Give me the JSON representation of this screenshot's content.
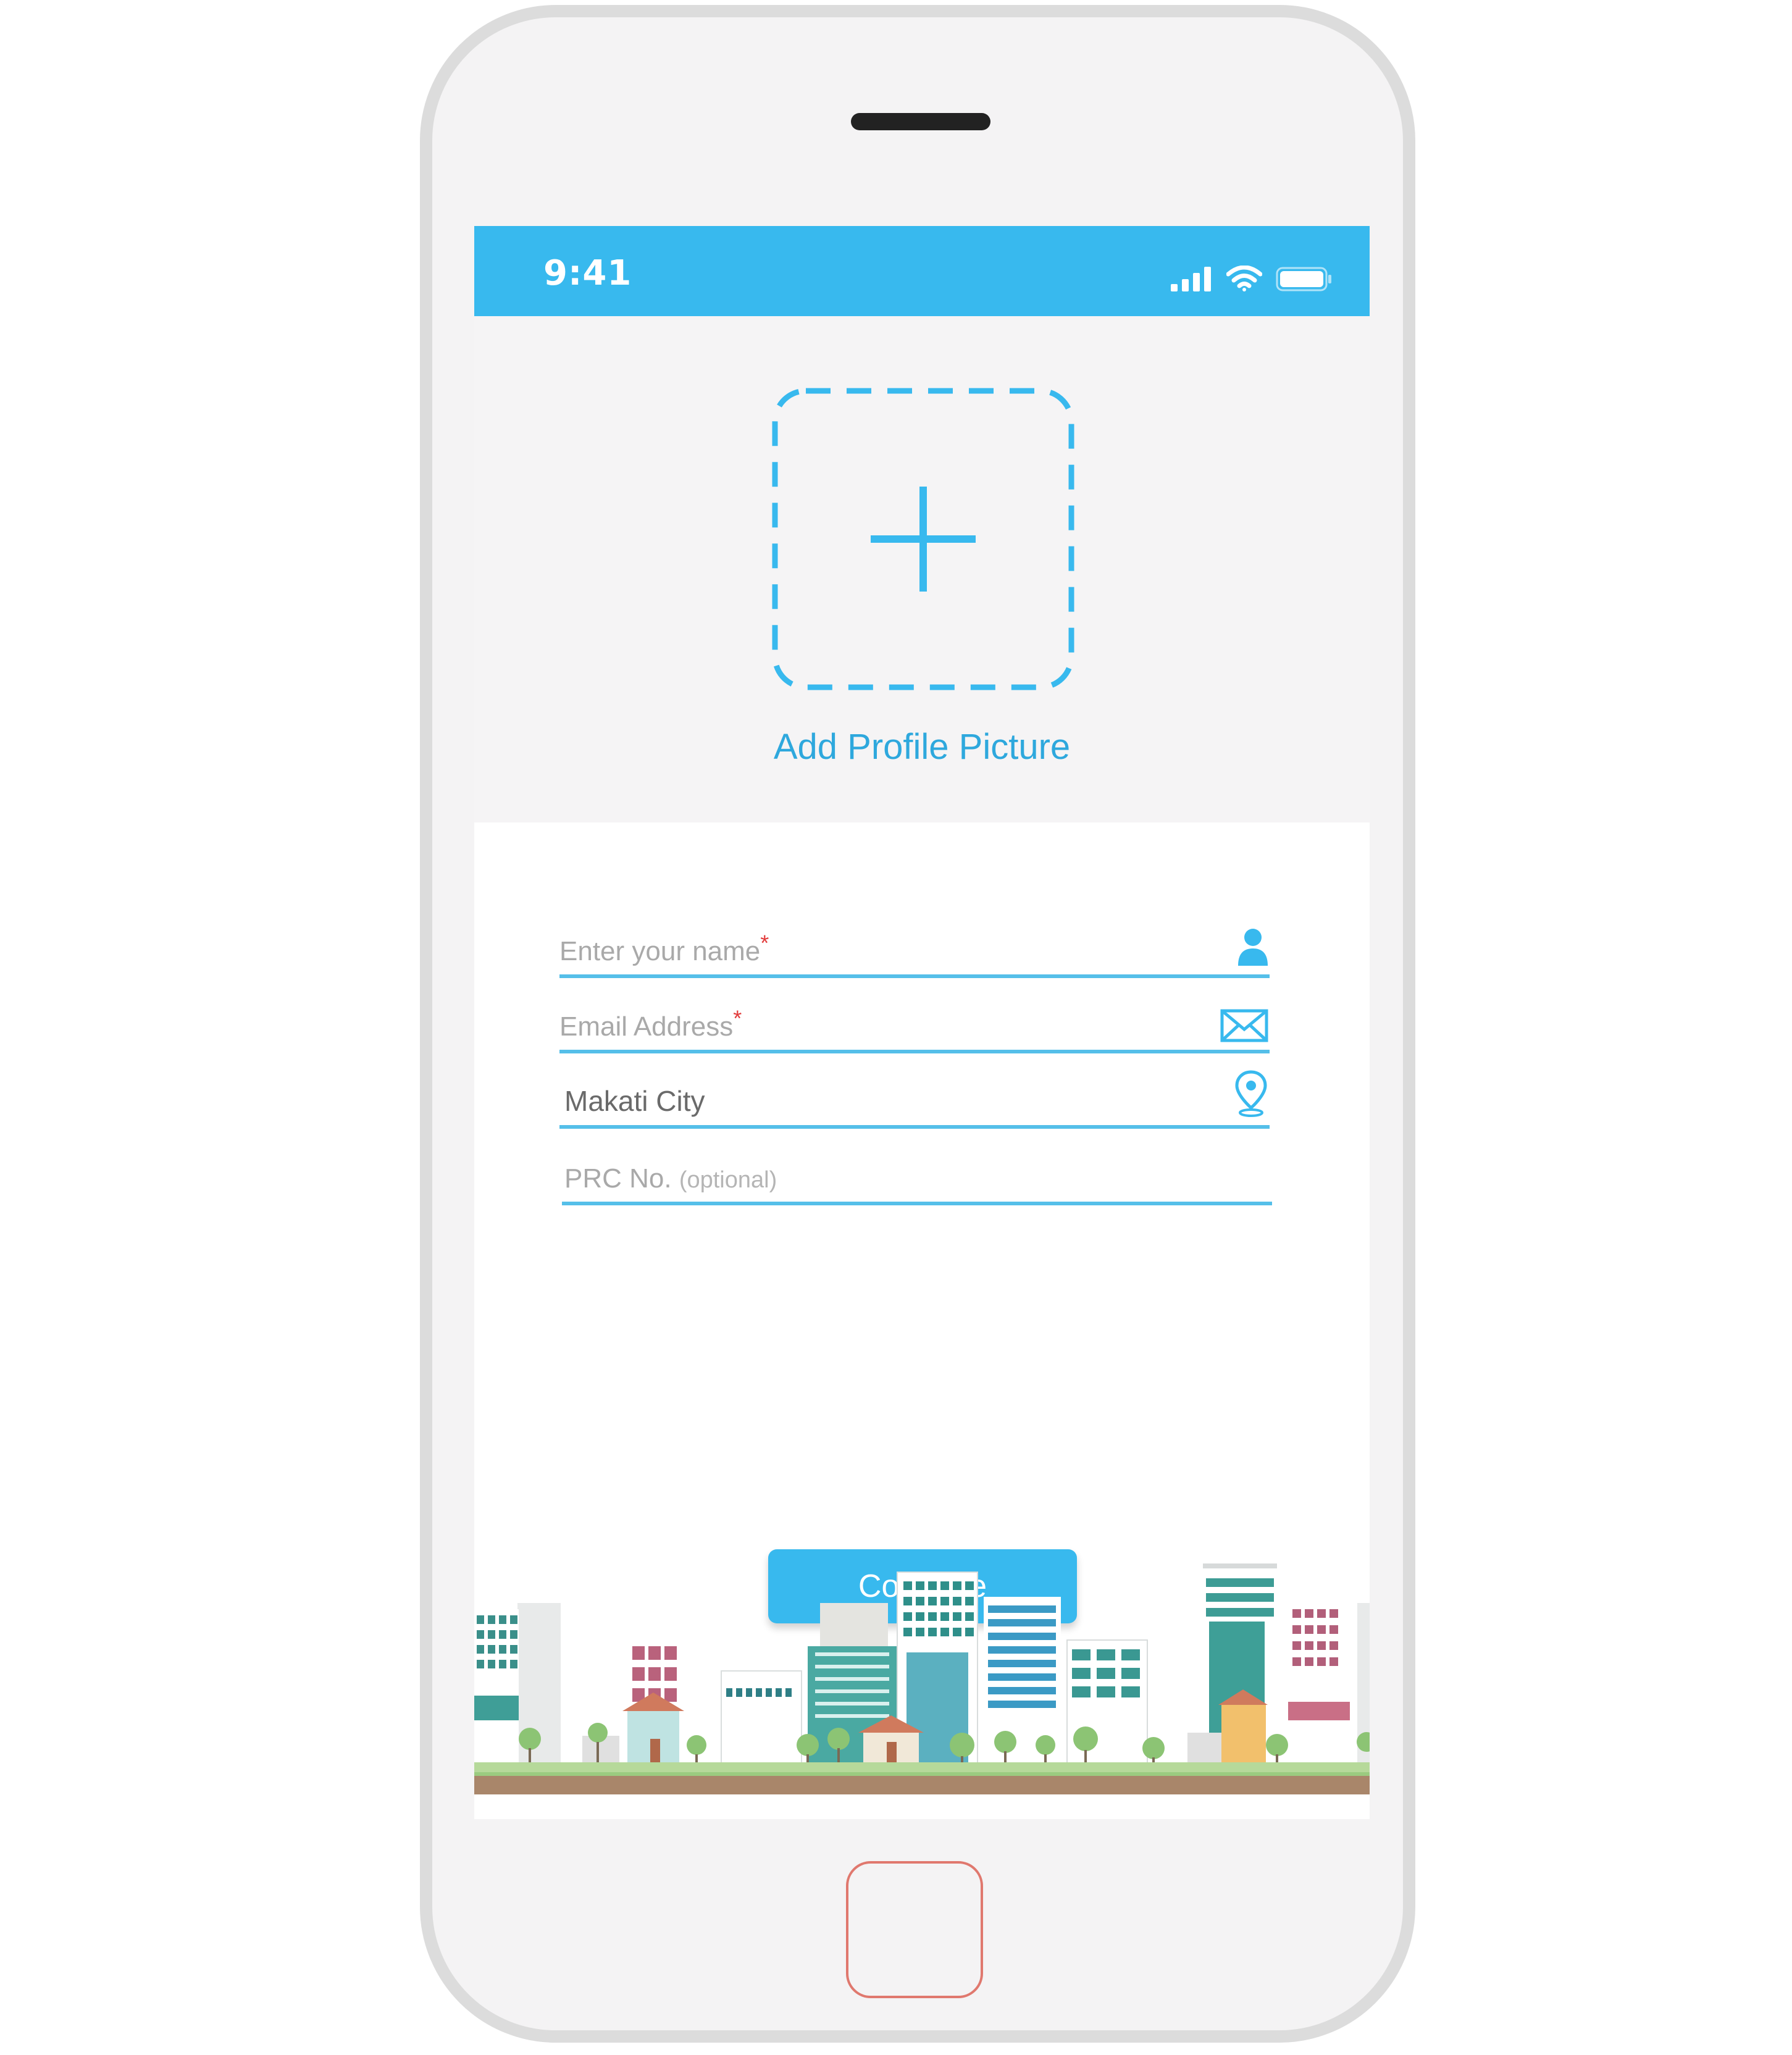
{
  "status_bar": {
    "time": "9:41",
    "icons": [
      "signal-icon",
      "wifi-icon",
      "battery-icon"
    ]
  },
  "profile": {
    "add_label": "Add Profile Picture",
    "icon": "plus-icon"
  },
  "form": {
    "fields": [
      {
        "placeholder": "Enter your name",
        "required": true,
        "required_mark": "*",
        "icon": "user-icon"
      },
      {
        "placeholder": "Email Address",
        "required": true,
        "required_mark": "*",
        "icon": "mail-icon"
      },
      {
        "value": "Makati City",
        "icon": "location-pin-icon"
      },
      {
        "placeholder": "PRC No.",
        "note": "(optional)"
      }
    ],
    "continue_label": "Continue"
  },
  "colors": {
    "accent": "#38b9ee",
    "label": "#2ea8dd",
    "required": "#e23b3b",
    "background": "#f5f4f5"
  }
}
